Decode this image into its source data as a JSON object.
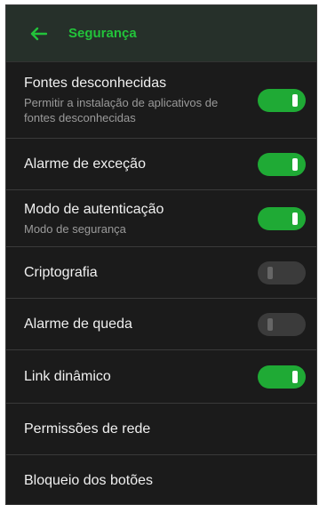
{
  "header": {
    "title": "Segurança",
    "back_icon": "arrow-left-icon"
  },
  "colors": {
    "accent": "#22c33a",
    "toggle_on": "#1faa35",
    "toggle_off": "#3b3b3b",
    "background": "#1b1b1b"
  },
  "settings": [
    {
      "label": "Fontes desconhecidas",
      "sub": "Permitir a instalação de aplicativos de fontes desconhecidas",
      "toggle": true
    },
    {
      "label": "Alarme de exceção",
      "toggle": true
    },
    {
      "label": "Modo de autenticação",
      "sub": "Modo de segurança",
      "toggle": true
    },
    {
      "label": "Criptografia",
      "toggle": false
    },
    {
      "label": "Alarme de queda",
      "toggle": false
    },
    {
      "label": "Link dinâmico",
      "toggle": true
    },
    {
      "label": "Permissões de rede"
    },
    {
      "label": "Bloqueio dos botões"
    }
  ]
}
